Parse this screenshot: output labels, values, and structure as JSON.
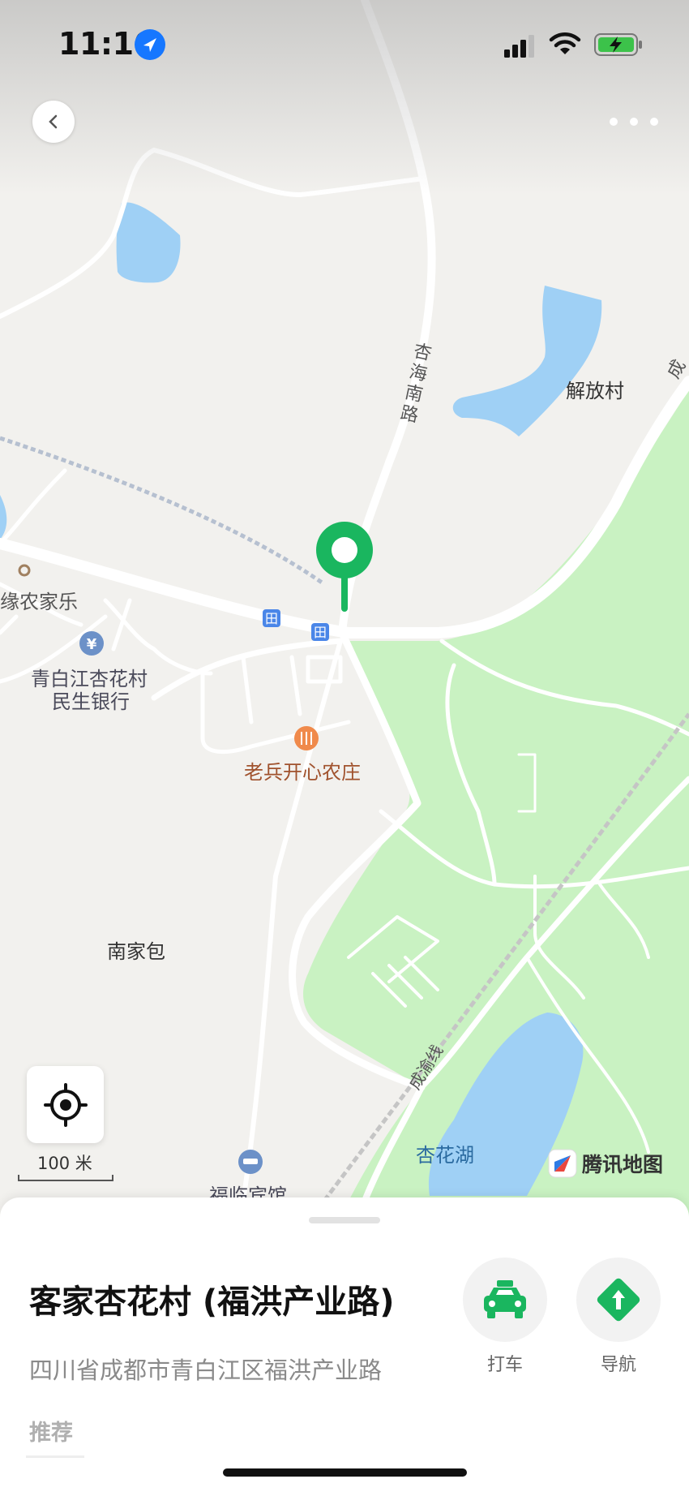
{
  "status": {
    "time": "11:16"
  },
  "map": {
    "labels": {
      "xinghai_road": "杏海南路",
      "jiefang": "解放村",
      "cheng": "成",
      "nongjiale": "缘农家乐",
      "bank_line1": "青白江杏花村",
      "bank_line2": "民生银行",
      "restaurant": "老兵开心农庄",
      "nanjiabao": "南家包",
      "railway": "成渝线",
      "lake": "杏花湖",
      "hotel": "福临宾馆"
    },
    "bus_glyph": "田",
    "bank_glyph": "¥",
    "scale_text": "100 米",
    "brand_text": "腾讯地图",
    "colors": {
      "land": "#f2f1ee",
      "green": "#c9f2c2",
      "water": "#9fd0f5",
      "pin": "#1ab65f",
      "road": "#ffffff"
    }
  },
  "sheet": {
    "title": "客家杏花村 (福洪产业路)",
    "address": "四川省成都市青白江区福洪产业路",
    "tab": "推荐",
    "actions": {
      "taxi": "打车",
      "nav": "导航"
    }
  }
}
